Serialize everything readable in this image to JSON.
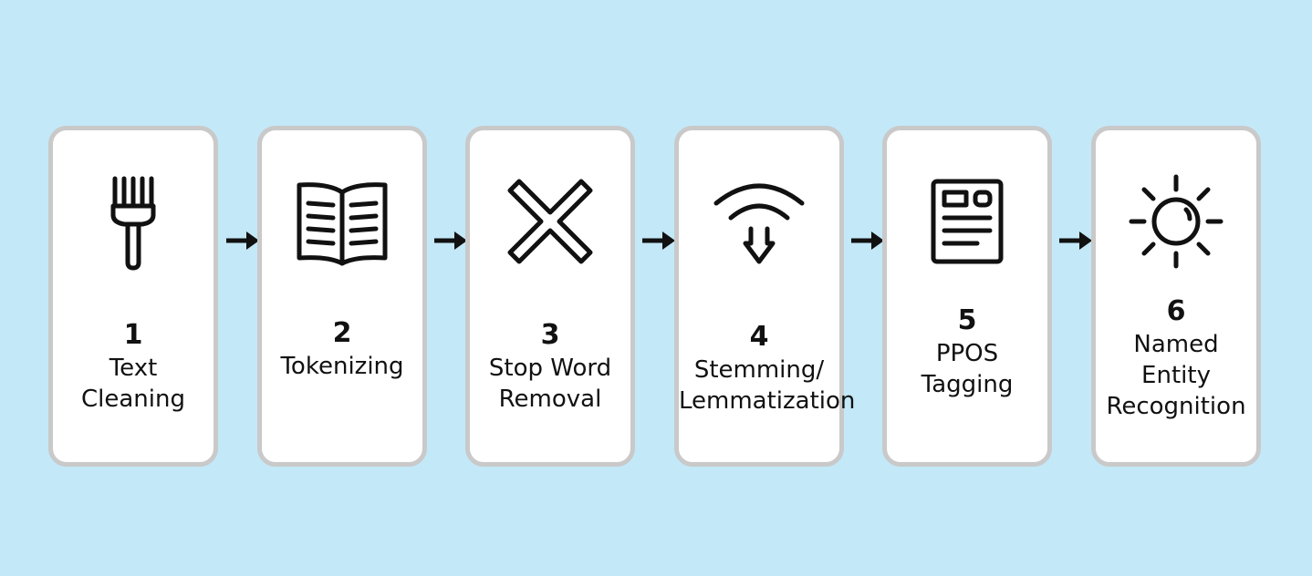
{
  "steps": [
    {
      "number": "1",
      "lines": [
        "Text",
        "Cleaning"
      ],
      "icon": "brush-icon"
    },
    {
      "number": "2",
      "lines": [
        "Tokenizing"
      ],
      "icon": "book-icon"
    },
    {
      "number": "3",
      "lines": [
        "Stop Word",
        "Removal"
      ],
      "icon": "cross-icon"
    },
    {
      "number": "4",
      "lines": [
        "Stemming/",
        "Lemmatization"
      ],
      "icon": "signal-arrow-icon"
    },
    {
      "number": "5",
      "lines": [
        "PPOS",
        "Tagging"
      ],
      "icon": "document-icon"
    },
    {
      "number": "6",
      "lines": [
        "Named",
        "Entity",
        "Recognition"
      ],
      "icon": "sun-icon"
    }
  ],
  "colors": {
    "background": "#c3e8f8",
    "card": "#ffffff",
    "border": "#c9c9c9",
    "ink": "#111111"
  }
}
